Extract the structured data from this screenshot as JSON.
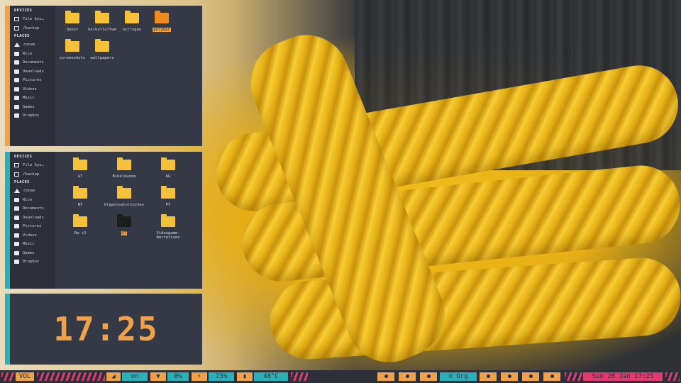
{
  "top_panel": {
    "sidebar": {
      "devices_header": "DEVICES",
      "devices": [
        "File Sys…",
        "/backup"
      ],
      "places_header": "PLACES",
      "places": [
        "conan",
        "Rice",
        "Documents",
        "Downloads",
        "Pictures",
        "Videos",
        "Music",
        "Games",
        "Dropbox"
      ]
    },
    "folders": [
      "dunst",
      "herbstluftwm",
      "nitrogen",
      "polybar",
      "screenshots",
      "wallpapers"
    ],
    "selected": "polybar"
  },
  "middle_panel": {
    "sidebar": {
      "devices_header": "DEVICES",
      "devices": [
        "File Sys…",
        "/backup"
      ],
      "places_header": "PLACES",
      "places": [
        "conan",
        "Rice",
        "Documents",
        "Downloads",
        "Pictures",
        "Videos",
        "Music",
        "Games",
        "Dropbox"
      ]
    },
    "folders": [
      "AT",
      "Bibelkunde",
      "KG",
      "NT",
      "Organisatorisches",
      "PT",
      "Rw +2",
      "ST",
      "Videogame-\nNarratives"
    ],
    "selected": "ST"
  },
  "clock": {
    "time": "17:25"
  },
  "statusbar": {
    "volume_label": "VOL",
    "network_value": "on",
    "disk_value": "0%",
    "battery_value": "73%",
    "temp_value": "48°C",
    "workspace_label": "⊙ Org",
    "datetime": "Sun 28 Jan 17:25"
  },
  "colors": {
    "orange": "#f0a24a",
    "teal": "#2bb0b8",
    "pink": "#e23a6e",
    "panel_bg": "#353845",
    "folder": "#f5c138"
  }
}
